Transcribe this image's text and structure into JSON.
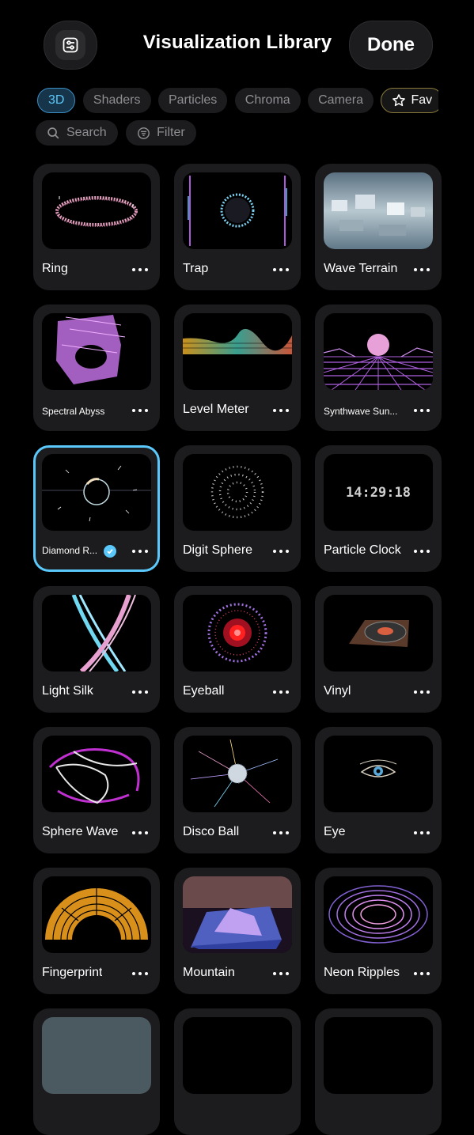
{
  "header": {
    "title": "Visualization Library",
    "done_label": "Done"
  },
  "categories": [
    {
      "label": "3D",
      "active": true
    },
    {
      "label": "Shaders"
    },
    {
      "label": "Particles"
    },
    {
      "label": "Chroma"
    },
    {
      "label": "Camera"
    },
    {
      "label": "Fav"
    }
  ],
  "tools": {
    "search_label": "Search",
    "filter_label": "Filter"
  },
  "visualizations": [
    {
      "name": "Ring"
    },
    {
      "name": "Trap"
    },
    {
      "name": "Wave Terrain"
    },
    {
      "name": "Spectral Abyss"
    },
    {
      "name": "Level Meter"
    },
    {
      "name": "Synthwave Sun..."
    },
    {
      "name": "Diamond R...",
      "selected": true
    },
    {
      "name": "Digit Sphere"
    },
    {
      "name": "Particle Clock",
      "clock_text": "14:29:18"
    },
    {
      "name": "Light Silk"
    },
    {
      "name": "Eyeball"
    },
    {
      "name": "Vinyl"
    },
    {
      "name": "Sphere Wave"
    },
    {
      "name": "Disco Ball"
    },
    {
      "name": "Eye"
    },
    {
      "name": "Fingerprint"
    },
    {
      "name": "Mountain"
    },
    {
      "name": "Neon Ripples"
    }
  ],
  "colors": {
    "accent": "#5ac8fa",
    "card_bg": "#1c1c1e",
    "fav_border": "#8a7a3a"
  },
  "icons": {
    "settings": "sliders-icon",
    "search": "magnifier-icon",
    "filter": "filter-icon",
    "favorite": "star-icon",
    "more": "ellipsis-icon",
    "selected": "checkmark-icon"
  }
}
